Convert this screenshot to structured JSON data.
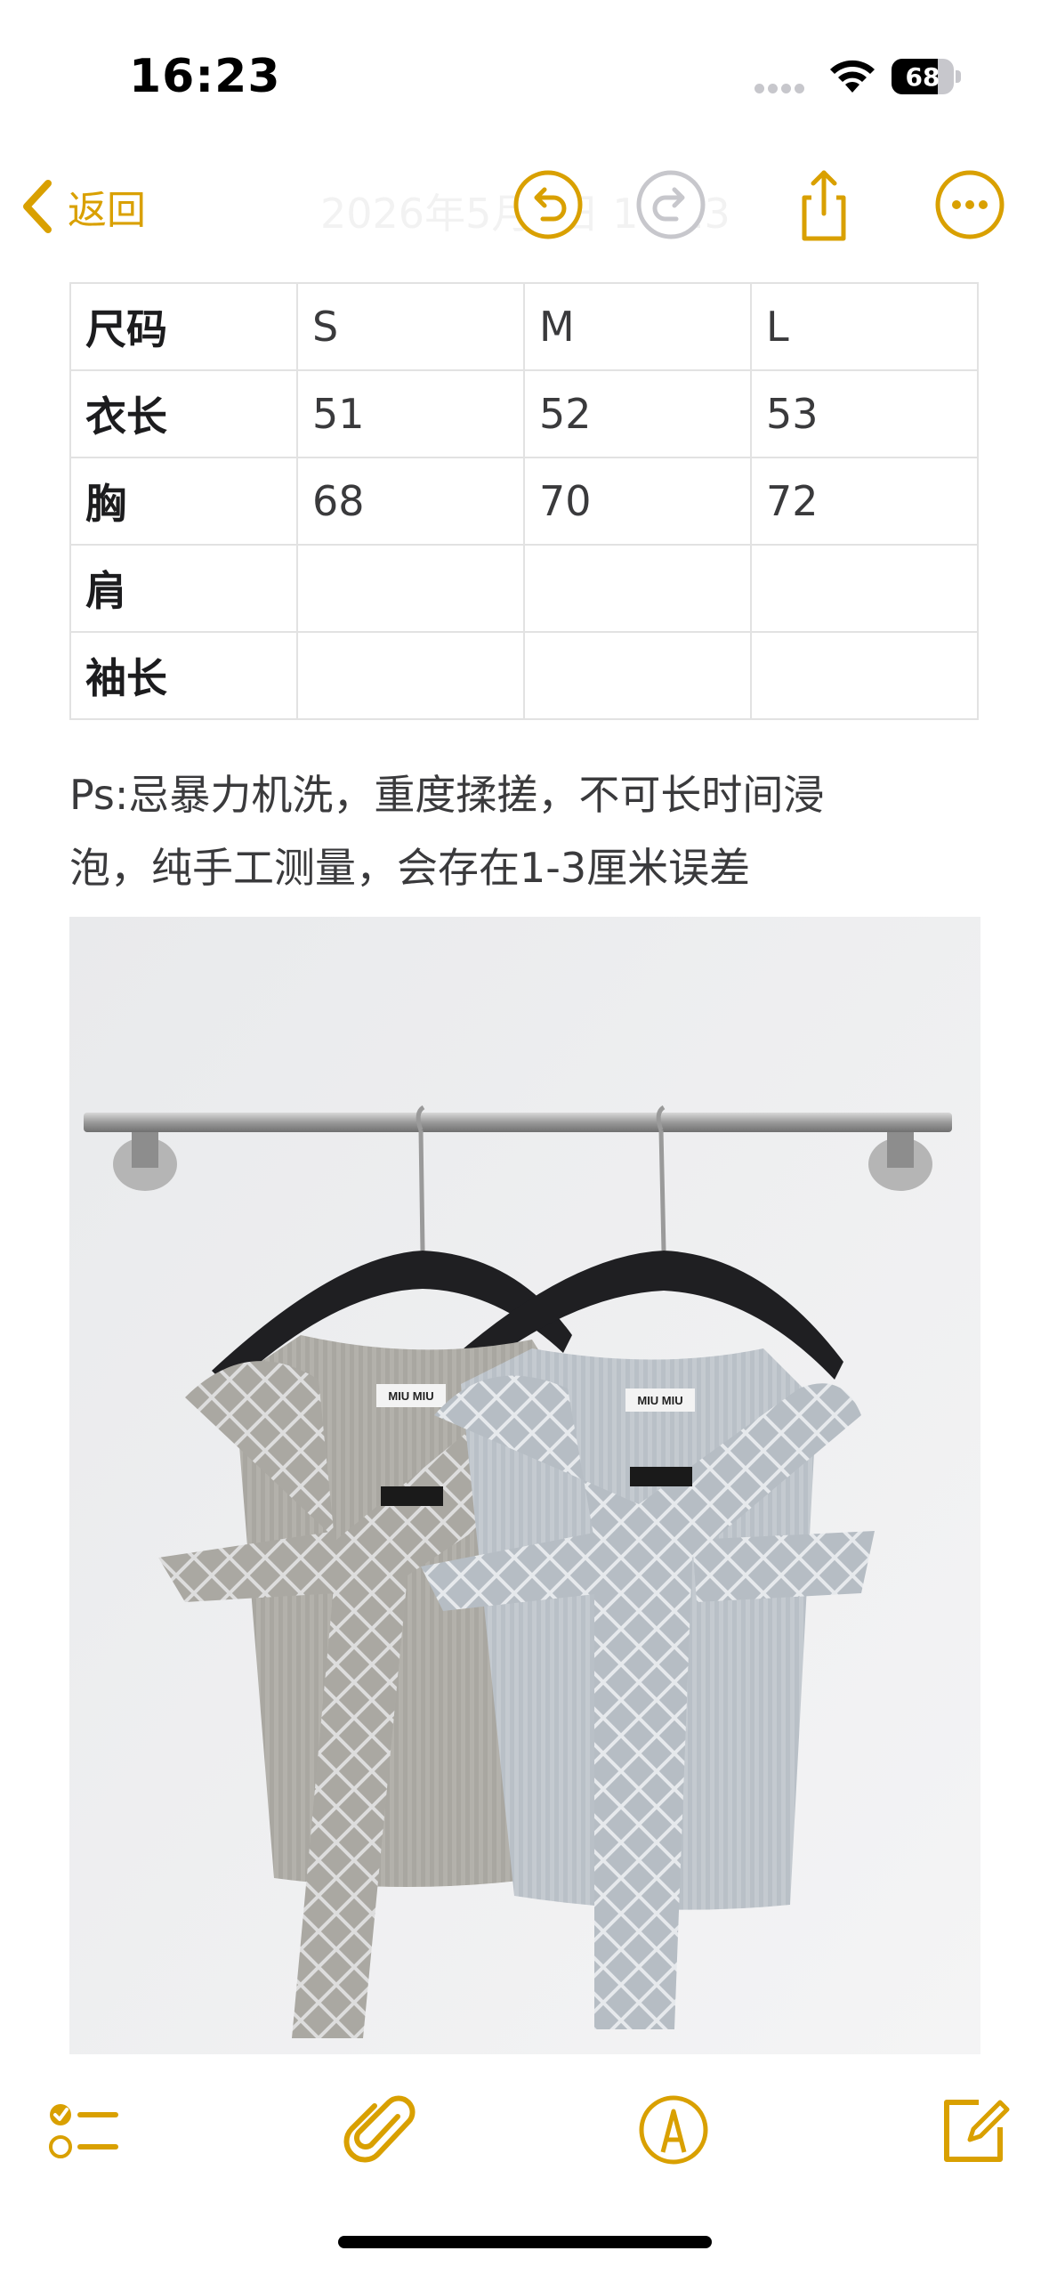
{
  "status_bar": {
    "time": "16:23",
    "battery": "68"
  },
  "nav": {
    "back_label": "返回",
    "title": "2026年5月1日 16:23"
  },
  "size_table": {
    "rows": [
      [
        "尺码",
        "S",
        "M",
        "L"
      ],
      [
        "衣长",
        "51",
        "52",
        "53"
      ],
      [
        "胸",
        "68",
        "70",
        "72"
      ],
      [
        "肩",
        "",
        "",
        ""
      ],
      [
        "袖长",
        "",
        "",
        ""
      ]
    ]
  },
  "note": {
    "line1": "Ps:忌暴力机洗，重度揉搓，不可长时间浸",
    "line2": "泡，纯手工测量，会存在1-3厘米误差"
  },
  "photo": {
    "label_left": "MIU MIU",
    "label_right": "MIU MIU"
  },
  "colors": {
    "accent": "#d9a000"
  },
  "icons": {
    "toolbar": [
      "checklist-icon",
      "paperclip-icon",
      "markup-icon",
      "compose-icon"
    ],
    "nav": [
      "chevron-left-icon",
      "undo-icon",
      "redo-icon",
      "share-icon",
      "more-icon"
    ]
  }
}
